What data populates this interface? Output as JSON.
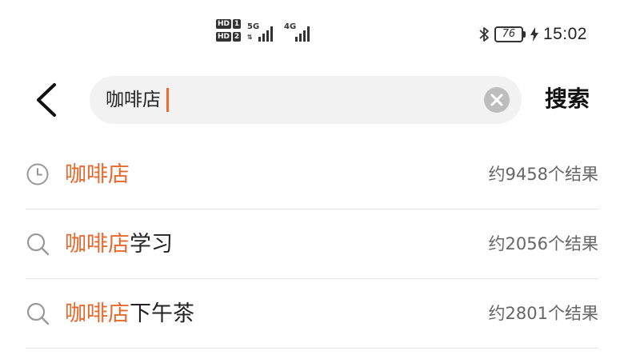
{
  "status_bar": {
    "hd1": "HD",
    "hd1_num": "1",
    "hd2": "HD",
    "hd2_num": "2",
    "net1": "5G",
    "net2": "4G",
    "battery_level": "76",
    "time": "15:02"
  },
  "search": {
    "query": "咖啡店",
    "button_label": "搜索"
  },
  "results": [
    {
      "icon": "clock-icon",
      "highlight": "咖啡店",
      "suffix": "",
      "count": "约9458个结果"
    },
    {
      "icon": "search-icon",
      "highlight": "咖啡店",
      "suffix": "学习",
      "count": "约2056个结果"
    },
    {
      "icon": "search-icon",
      "highlight": "咖啡店",
      "suffix": "下午茶",
      "count": "约2801个结果"
    }
  ],
  "colors": {
    "accent": "#e9682c",
    "caret": "#ee6a2c",
    "search_bg": "#f2f2f2"
  }
}
